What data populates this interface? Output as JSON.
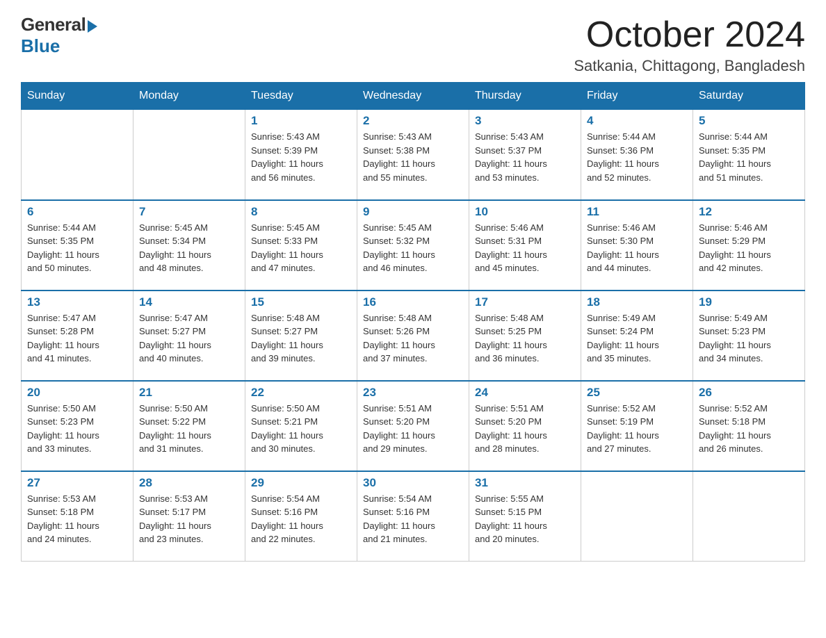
{
  "logo": {
    "general_text": "General",
    "blue_text": "Blue"
  },
  "title": {
    "month_year": "October 2024",
    "location": "Satkania, Chittagong, Bangladesh"
  },
  "headers": [
    "Sunday",
    "Monday",
    "Tuesday",
    "Wednesday",
    "Thursday",
    "Friday",
    "Saturday"
  ],
  "weeks": [
    [
      {
        "day": "",
        "info": ""
      },
      {
        "day": "",
        "info": ""
      },
      {
        "day": "1",
        "info": "Sunrise: 5:43 AM\nSunset: 5:39 PM\nDaylight: 11 hours\nand 56 minutes."
      },
      {
        "day": "2",
        "info": "Sunrise: 5:43 AM\nSunset: 5:38 PM\nDaylight: 11 hours\nand 55 minutes."
      },
      {
        "day": "3",
        "info": "Sunrise: 5:43 AM\nSunset: 5:37 PM\nDaylight: 11 hours\nand 53 minutes."
      },
      {
        "day": "4",
        "info": "Sunrise: 5:44 AM\nSunset: 5:36 PM\nDaylight: 11 hours\nand 52 minutes."
      },
      {
        "day": "5",
        "info": "Sunrise: 5:44 AM\nSunset: 5:35 PM\nDaylight: 11 hours\nand 51 minutes."
      }
    ],
    [
      {
        "day": "6",
        "info": "Sunrise: 5:44 AM\nSunset: 5:35 PM\nDaylight: 11 hours\nand 50 minutes."
      },
      {
        "day": "7",
        "info": "Sunrise: 5:45 AM\nSunset: 5:34 PM\nDaylight: 11 hours\nand 48 minutes."
      },
      {
        "day": "8",
        "info": "Sunrise: 5:45 AM\nSunset: 5:33 PM\nDaylight: 11 hours\nand 47 minutes."
      },
      {
        "day": "9",
        "info": "Sunrise: 5:45 AM\nSunset: 5:32 PM\nDaylight: 11 hours\nand 46 minutes."
      },
      {
        "day": "10",
        "info": "Sunrise: 5:46 AM\nSunset: 5:31 PM\nDaylight: 11 hours\nand 45 minutes."
      },
      {
        "day": "11",
        "info": "Sunrise: 5:46 AM\nSunset: 5:30 PM\nDaylight: 11 hours\nand 44 minutes."
      },
      {
        "day": "12",
        "info": "Sunrise: 5:46 AM\nSunset: 5:29 PM\nDaylight: 11 hours\nand 42 minutes."
      }
    ],
    [
      {
        "day": "13",
        "info": "Sunrise: 5:47 AM\nSunset: 5:28 PM\nDaylight: 11 hours\nand 41 minutes."
      },
      {
        "day": "14",
        "info": "Sunrise: 5:47 AM\nSunset: 5:27 PM\nDaylight: 11 hours\nand 40 minutes."
      },
      {
        "day": "15",
        "info": "Sunrise: 5:48 AM\nSunset: 5:27 PM\nDaylight: 11 hours\nand 39 minutes."
      },
      {
        "day": "16",
        "info": "Sunrise: 5:48 AM\nSunset: 5:26 PM\nDaylight: 11 hours\nand 37 minutes."
      },
      {
        "day": "17",
        "info": "Sunrise: 5:48 AM\nSunset: 5:25 PM\nDaylight: 11 hours\nand 36 minutes."
      },
      {
        "day": "18",
        "info": "Sunrise: 5:49 AM\nSunset: 5:24 PM\nDaylight: 11 hours\nand 35 minutes."
      },
      {
        "day": "19",
        "info": "Sunrise: 5:49 AM\nSunset: 5:23 PM\nDaylight: 11 hours\nand 34 minutes."
      }
    ],
    [
      {
        "day": "20",
        "info": "Sunrise: 5:50 AM\nSunset: 5:23 PM\nDaylight: 11 hours\nand 33 minutes."
      },
      {
        "day": "21",
        "info": "Sunrise: 5:50 AM\nSunset: 5:22 PM\nDaylight: 11 hours\nand 31 minutes."
      },
      {
        "day": "22",
        "info": "Sunrise: 5:50 AM\nSunset: 5:21 PM\nDaylight: 11 hours\nand 30 minutes."
      },
      {
        "day": "23",
        "info": "Sunrise: 5:51 AM\nSunset: 5:20 PM\nDaylight: 11 hours\nand 29 minutes."
      },
      {
        "day": "24",
        "info": "Sunrise: 5:51 AM\nSunset: 5:20 PM\nDaylight: 11 hours\nand 28 minutes."
      },
      {
        "day": "25",
        "info": "Sunrise: 5:52 AM\nSunset: 5:19 PM\nDaylight: 11 hours\nand 27 minutes."
      },
      {
        "day": "26",
        "info": "Sunrise: 5:52 AM\nSunset: 5:18 PM\nDaylight: 11 hours\nand 26 minutes."
      }
    ],
    [
      {
        "day": "27",
        "info": "Sunrise: 5:53 AM\nSunset: 5:18 PM\nDaylight: 11 hours\nand 24 minutes."
      },
      {
        "day": "28",
        "info": "Sunrise: 5:53 AM\nSunset: 5:17 PM\nDaylight: 11 hours\nand 23 minutes."
      },
      {
        "day": "29",
        "info": "Sunrise: 5:54 AM\nSunset: 5:16 PM\nDaylight: 11 hours\nand 22 minutes."
      },
      {
        "day": "30",
        "info": "Sunrise: 5:54 AM\nSunset: 5:16 PM\nDaylight: 11 hours\nand 21 minutes."
      },
      {
        "day": "31",
        "info": "Sunrise: 5:55 AM\nSunset: 5:15 PM\nDaylight: 11 hours\nand 20 minutes."
      },
      {
        "day": "",
        "info": ""
      },
      {
        "day": "",
        "info": ""
      }
    ]
  ]
}
